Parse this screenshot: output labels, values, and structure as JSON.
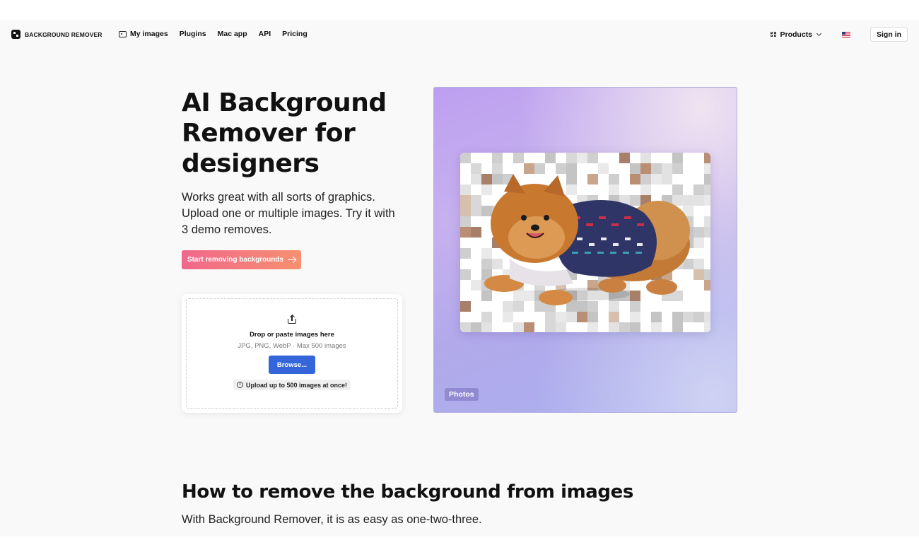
{
  "nav": {
    "brand": "BACKGROUND REMOVER",
    "links": [
      "My images",
      "Plugins",
      "Mac app",
      "API",
      "Pricing"
    ],
    "products": "Products",
    "sign_in": "Sign in"
  },
  "hero": {
    "title": "AI Background Remover for designers",
    "subtitle": "Works great with all sorts of graphics. Upload one or multiple images. Try it with 3 demo removes.",
    "cta": "Start removing backgrounds"
  },
  "upload": {
    "title": "Drop or paste images here",
    "formats": "JPG, PNG, WebP · Max 500 images",
    "browse": "Browse...",
    "note": "Upload up to 500 images at once!"
  },
  "demo": {
    "tag": "Photos"
  },
  "howto": {
    "title": "How to remove the background from images",
    "subtitle": "With Background Remover, it is as easy as one-two-three."
  }
}
